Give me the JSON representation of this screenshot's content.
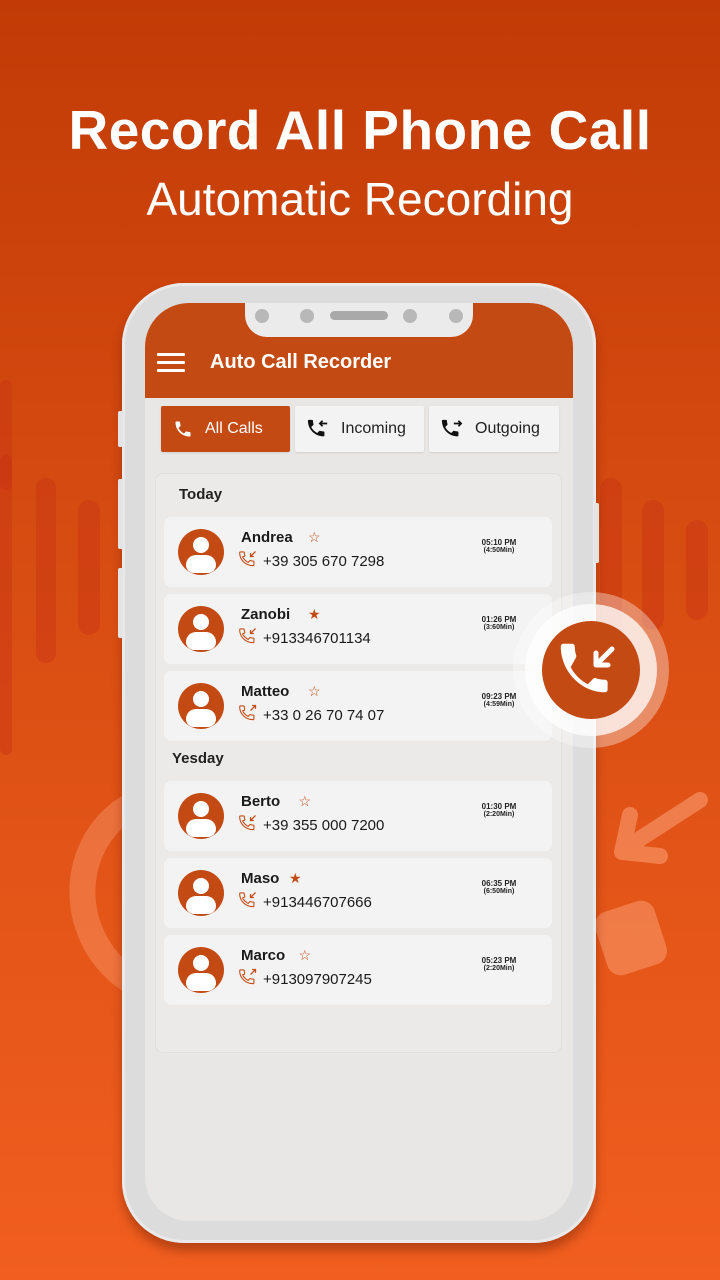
{
  "promo": {
    "headline": "Record All Phone Call",
    "subheadline": "Automatic Recording"
  },
  "app": {
    "title": "Auto Call Recorder",
    "accent_color": "#c44a14"
  },
  "tabs": [
    {
      "label": "All Calls",
      "icon": "phone-icon",
      "active": true
    },
    {
      "label": "Incoming",
      "icon": "incoming-call-icon",
      "active": false
    },
    {
      "label": "Outgoing",
      "icon": "outgoing-call-icon",
      "active": false
    }
  ],
  "sections": [
    {
      "title": "Today",
      "calls": [
        {
          "name": "Andrea",
          "starred": false,
          "direction": "incoming",
          "number": "+39 305 670 7298",
          "time": "05:10 PM",
          "duration": "(4:50Min)"
        },
        {
          "name": "Zanobi",
          "starred": true,
          "direction": "incoming",
          "number": "+913346701134",
          "time": "01:26 PM",
          "duration": "(3:60Min)"
        },
        {
          "name": "Matteo",
          "starred": false,
          "direction": "outgoing",
          "number": "+33 0 26 70 74 07",
          "time": "09:23 PM",
          "duration": "(4:59Min)"
        }
      ]
    },
    {
      "title": "Yesday",
      "calls": [
        {
          "name": "Berto",
          "starred": false,
          "direction": "incoming",
          "number": "+39 355 000 7200",
          "time": "01:30 PM",
          "duration": "(2:20Min)"
        },
        {
          "name": "Maso",
          "starred": true,
          "direction": "incoming",
          "number": "+913446707666",
          "time": "06:35 PM",
          "duration": "(6:50Min)"
        },
        {
          "name": "Marco",
          "starred": false,
          "direction": "outgoing",
          "number": "+913097907245",
          "time": "05:23 PM",
          "duration": "(2:20Min)"
        }
      ]
    }
  ],
  "fab": {
    "icon": "incoming-call-icon"
  },
  "icons": {
    "star_filled": "★",
    "star_empty": "☆"
  }
}
